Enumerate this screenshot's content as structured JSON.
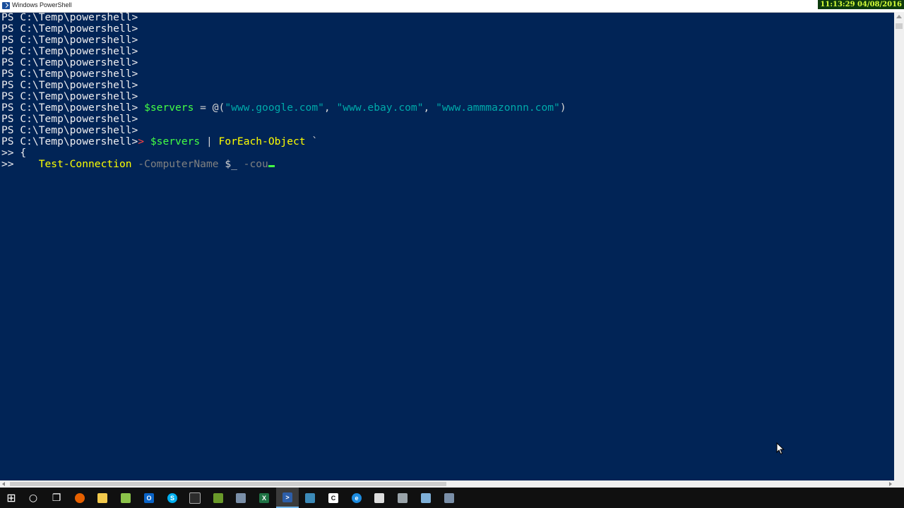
{
  "window": {
    "title": "Windows PowerShell",
    "clock": "11:13:29  04/08/2016"
  },
  "console": {
    "prompt": "PS C:\\Temp\\powershell>",
    "line9": {
      "var": "$servers",
      "eq": " = ",
      "at": "@(",
      "s1": "\"www.google.com\"",
      "c1": ", ",
      "s2": "\"www.ebay.com\"",
      "c2": ", ",
      "s3": "\"www.ammmazonnn.com\"",
      "close": ")"
    },
    "line12": {
      "gt": ">",
      "var": "$servers",
      "pipe": " | ",
      "cmd": "ForEach-Object",
      "tick": " `"
    },
    "line13": {
      "cont": ">> ",
      "brace": "{"
    },
    "line14": {
      "cont": ">>    ",
      "cmd": "Test-Connection",
      "param1": " -ComputerName",
      "var": " $_",
      "param2": " -cou"
    }
  },
  "taskbar": {
    "items": [
      {
        "name": "start-icon",
        "glyph": "⊞",
        "color": "#ffffff"
      },
      {
        "name": "cortana-icon",
        "glyph": "○",
        "color": "#ffffff"
      },
      {
        "name": "task-view-icon",
        "glyph": "❐",
        "color": "#ffffff"
      },
      {
        "name": "firefox-icon",
        "glyph": "",
        "color": "#e66000"
      },
      {
        "name": "file-explorer-icon",
        "glyph": "",
        "color": "#f2c94c"
      },
      {
        "name": "notepad-plus-icon",
        "glyph": "",
        "color": "#8bc34a"
      },
      {
        "name": "outlook-icon",
        "glyph": "O",
        "color": "#0a64c8"
      },
      {
        "name": "skype-icon",
        "glyph": "S",
        "color": "#00aff0"
      },
      {
        "name": "terminal-icon",
        "glyph": "",
        "color": "#2b2b2b"
      },
      {
        "name": "package-icon",
        "glyph": "",
        "color": "#6a9a2a"
      },
      {
        "name": "virtualbox-icon",
        "glyph": "",
        "color": "#7a8fa8"
      },
      {
        "name": "excel-icon",
        "glyph": "X",
        "color": "#1f7244"
      },
      {
        "name": "powershell-icon",
        "glyph": ">",
        "color": "#2d5ea8"
      },
      {
        "name": "powershell-ise-icon",
        "glyph": "",
        "color": "#3c8ab8"
      },
      {
        "name": "citrix-icon",
        "glyph": "C",
        "color": "#ffffff"
      },
      {
        "name": "edge-icon",
        "glyph": "e",
        "color": "#1d8ce0"
      },
      {
        "name": "mail-icon",
        "glyph": "",
        "color": "#dddddd"
      },
      {
        "name": "tools-icon",
        "glyph": "",
        "color": "#9aa4aa"
      },
      {
        "name": "notes-icon",
        "glyph": "",
        "color": "#7fb0d8"
      },
      {
        "name": "network-admin-icon",
        "glyph": "",
        "color": "#7a8fa8"
      }
    ]
  }
}
